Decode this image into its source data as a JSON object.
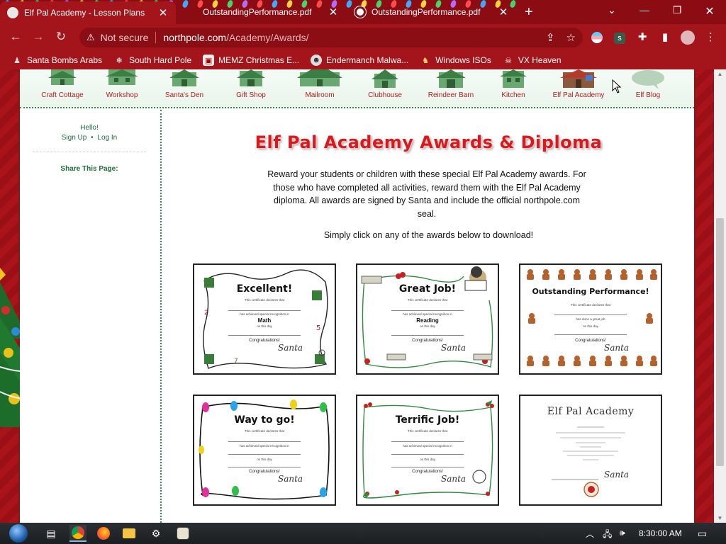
{
  "browser": {
    "tabs": [
      {
        "title": "Elf Pal Academy - Lesson Plans a",
        "active": true
      },
      {
        "title": "OutstandingPerformance.pdf",
        "active": false
      },
      {
        "title": "OutstandingPerformance.pdf",
        "active": false
      }
    ],
    "new_tab_icon": "plus-icon",
    "address": {
      "security_label": "Not secure",
      "host": "northpole.com",
      "path": "/Academy/Awards/"
    },
    "bookmarks": [
      "Santa Bombs Arabs",
      "South Hard Pole",
      "MEMZ Christmas E...",
      "Endermanch Malwa...",
      "Windows ISOs",
      "VX Heaven"
    ],
    "colors": {
      "frame": "#a4141b",
      "tabstrip": "#8b0d13"
    }
  },
  "site": {
    "nav": [
      "Craft Cottage",
      "Workshop",
      "Santa's Den",
      "Gift Shop",
      "Mailroom",
      "Clubhouse",
      "Reindeer Barn",
      "Kitchen",
      "Elf Pal Academy",
      "Elf Blog"
    ],
    "sidebar": {
      "hello": "Hello!",
      "sign_up": "Sign Up",
      "separator": "•",
      "log_in": "Log In",
      "share": "Share This Page:"
    },
    "title": "Elf Pal Academy Awards & Diploma",
    "intro": "Reward your students or children with these special Elf Pal Academy awards. For those who have completed all activities, reward them with the Elf Pal Academy diploma. All awards are signed by Santa and include the official northpole.com seal.",
    "cta": "Simply click on any of the awards below to download!",
    "awards": [
      {
        "title": "Excellent!",
        "declares": "This certificate declares that",
        "line2": "has achieved special recognition in",
        "subject": "Math",
        "line3": "on this day",
        "congrats": "Congratulations!",
        "signature": "Santa"
      },
      {
        "title": "Great Job!",
        "declares": "This certificate declares that",
        "line2": "has achieved special recognition in",
        "subject": "Reading",
        "line3": "on this day",
        "congrats": "Congratulations!",
        "signature": "Santa"
      },
      {
        "title": "Outstanding Performance!",
        "declares": "This certificate declares that",
        "line2": "has done a great job",
        "line3": "on this day",
        "congrats": "Congratulations!",
        "signature": "Santa"
      },
      {
        "title": "Way to go!",
        "declares": "This certificate declares that",
        "line2": "has achieved special recognition in",
        "line3": "on this day",
        "congrats": "Congratulations!",
        "signature": "Santa"
      },
      {
        "title": "Terrific Job!",
        "declares": "This certificate declares that",
        "line2": "has achieved special recognition in",
        "line3": "on this day",
        "congrats": "Congratulations!",
        "signature": "Santa"
      },
      {
        "title": "Elf Pal Academy",
        "signature": "Santa"
      }
    ]
  },
  "taskbar": {
    "time": "8:30:00 AM",
    "icons": [
      "start-orb-icon",
      "task-view-icon",
      "chrome-icon",
      "firefox-icon",
      "file-explorer-icon",
      "settings-icon",
      "app-icon"
    ]
  }
}
